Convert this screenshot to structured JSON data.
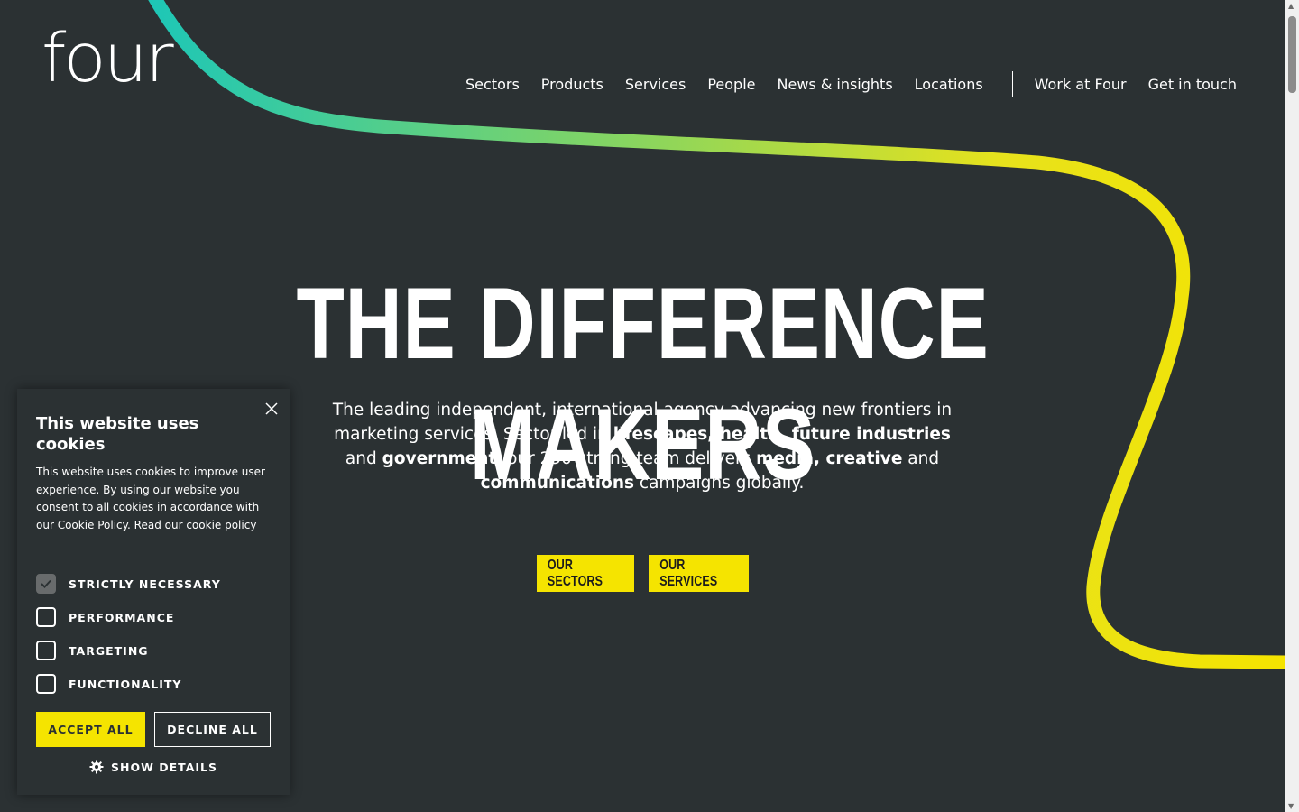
{
  "logo": {
    "text": "four"
  },
  "nav": {
    "items": [
      "Sectors",
      "Products",
      "Services",
      "People",
      "News & insights",
      "Locations"
    ],
    "secondary": [
      "Work at Four",
      "Get in touch"
    ]
  },
  "hero": {
    "title": "THE DIFFERENCE MAKERS",
    "text_parts": [
      {
        "t": "The leading independent, international agency advancing new frontiers in marketing services. Sector-led in ",
        "b": false
      },
      {
        "t": "lifescapes, health, future industries",
        "b": true
      },
      {
        "t": " and ",
        "b": false
      },
      {
        "t": "government",
        "b": true
      },
      {
        "t": ", our 250-strong team delivers ",
        "b": false
      },
      {
        "t": "media, creative",
        "b": true
      },
      {
        "t": " and ",
        "b": false
      },
      {
        "t": "communications",
        "b": true
      },
      {
        "t": " campaigns globally.",
        "b": false
      }
    ],
    "cta_sectors": "OUR SECTORS",
    "cta_services": "OUR SERVICES"
  },
  "cookie": {
    "title": "This website uses cookies",
    "description": "This website uses cookies to improve user experience. By using our website you consent to all cookies in accordance with our Cookie Policy. Read our cookie policy",
    "options": [
      {
        "label": "STRICTLY NECESSARY",
        "checked": true
      },
      {
        "label": "PERFORMANCE",
        "checked": false
      },
      {
        "label": "TARGETING",
        "checked": false
      },
      {
        "label": "FUNCTIONALITY",
        "checked": false
      }
    ],
    "accept_label": "ACCEPT ALL",
    "decline_label": "DECLINE ALL",
    "details_label": "SHOW DETAILS"
  },
  "colors": {
    "background": "#2b3133",
    "accent_yellow": "#f5e400",
    "accent_teal": "#22c9b0"
  }
}
